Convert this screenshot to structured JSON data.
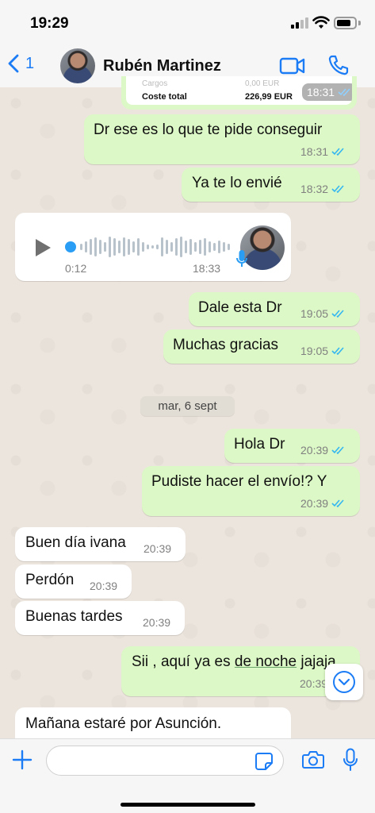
{
  "status_bar": {
    "time": "19:29"
  },
  "header": {
    "back_count": "1",
    "contact_name": "Rubén Martinez"
  },
  "image_message": {
    "row1_label": "Cargos",
    "row1_value": "0,00 EUR",
    "row2_label": "Coste total",
    "row2_value": "226,99 EUR",
    "time": "18:31"
  },
  "messages": [
    {
      "text": "Dr ese es lo que te pide conseguir",
      "time": "18:31"
    },
    {
      "text": "Ya te lo envié",
      "time": "18:32"
    },
    {
      "text": "Dale esta Dr",
      "time": "19:05"
    },
    {
      "text": "Muchas gracias",
      "time": "19:05"
    },
    {
      "text": "Hola Dr",
      "time": "20:39"
    },
    {
      "text": "Pudiste hacer el envío!? Y",
      "time": "20:39"
    },
    {
      "text": "Buen día ivana",
      "time": "20:39"
    },
    {
      "text": "Perdón",
      "time": "20:39"
    },
    {
      "text": "Buenas tardes",
      "time": "20:39"
    },
    {
      "text_a": "Sii , aquí ya es ",
      "text_b": "de noche",
      "text_c": " jajaja",
      "time": "20:39"
    },
    {
      "text": "Mañana estaré por Asunción."
    }
  ],
  "voice_message": {
    "duration": "0:12",
    "time": "18:33",
    "progress": 0
  },
  "date_separator": "mar, 6 sept",
  "input": {
    "placeholder": ""
  },
  "colors": {
    "accent": "#1b7cf5",
    "outgoing": "#dcf8c6",
    "incoming": "#ffffff",
    "ticks": "#34b7f1"
  }
}
